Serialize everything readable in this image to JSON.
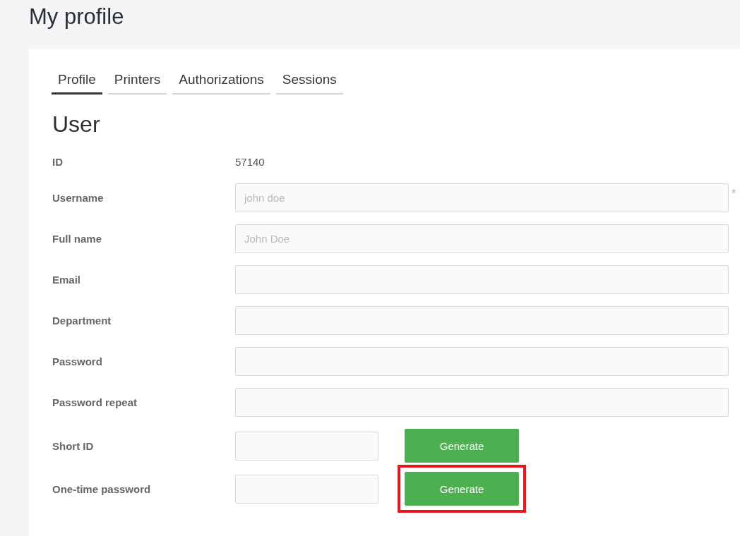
{
  "page": {
    "title": "My profile"
  },
  "tabs": [
    {
      "label": "Profile",
      "selected": true
    },
    {
      "label": "Printers",
      "selected": false
    },
    {
      "label": "Authorizations",
      "selected": false
    },
    {
      "label": "Sessions",
      "selected": false
    }
  ],
  "section": {
    "title": "User"
  },
  "fields": [
    {
      "kind": "static",
      "label": "ID",
      "value": "57140"
    },
    {
      "kind": "input",
      "label": "Username",
      "placeholder": "john doe",
      "required_mark": "*"
    },
    {
      "kind": "input",
      "label": "Full name",
      "placeholder": "John Doe"
    },
    {
      "kind": "input",
      "label": "Email"
    },
    {
      "kind": "input",
      "label": "Department"
    },
    {
      "kind": "input",
      "label": "Password"
    },
    {
      "kind": "input",
      "label": "Password repeat"
    },
    {
      "kind": "generate",
      "label": "Short ID",
      "button": "Generate",
      "highlighted": false
    },
    {
      "kind": "generate",
      "label": "One-time password",
      "button": "Generate",
      "highlighted": true
    }
  ]
}
